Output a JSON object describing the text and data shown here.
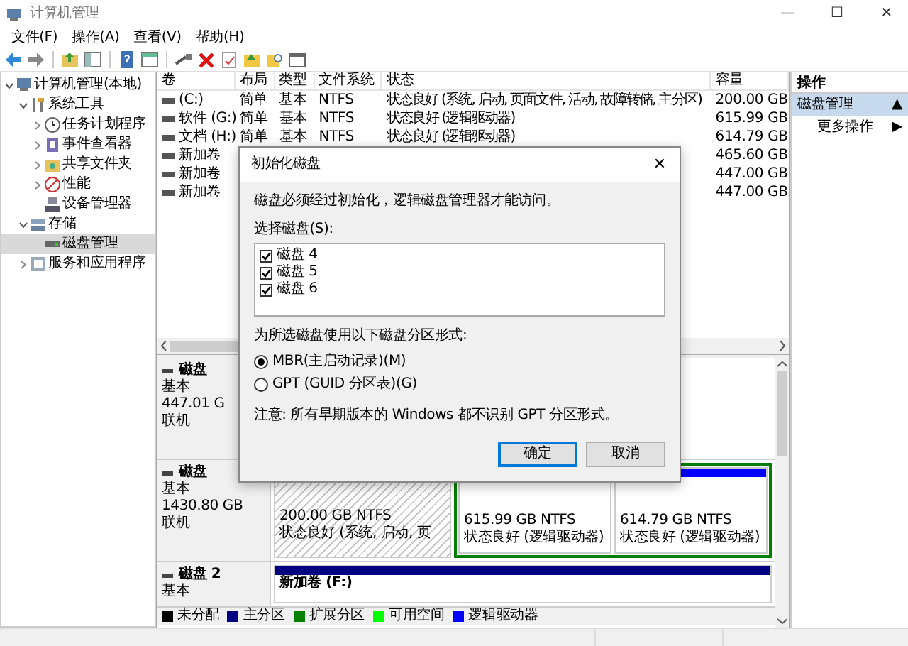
{
  "window": {
    "title": "计算机管理",
    "controls": [
      "—",
      "☐",
      "✕"
    ]
  },
  "menu": [
    "文件(F)",
    "操作(A)",
    "查看(V)",
    "帮助(H)"
  ],
  "tree": [
    {
      "label": "计算机管理(本地)",
      "selected": false,
      "expanded": true,
      "children": [
        {
          "label": "系统工具",
          "selected": false,
          "expanded": true,
          "children": [
            {
              "label": "任务计划程序",
              "selected": false,
              "expanded": false
            },
            {
              "label": "事件查看器",
              "selected": false,
              "expanded": false
            },
            {
              "label": "共享文件夹",
              "selected": false,
              "expanded": false
            },
            {
              "label": "性能",
              "selected": false,
              "expanded": false
            },
            {
              "label": "设备管理器",
              "selected": false
            }
          ]
        },
        {
          "label": "存储",
          "selected": false,
          "expanded": true,
          "children": [
            {
              "label": "磁盘管理",
              "selected": true
            }
          ]
        },
        {
          "label": "服务和应用程序",
          "selected": false,
          "expanded": false
        }
      ]
    }
  ],
  "volumes": {
    "columns": [
      "卷",
      "布局",
      "类型",
      "文件系统",
      "状态",
      "容量"
    ],
    "rows": [
      {
        "volume": "(C:)",
        "layout": "简单",
        "type": "基本",
        "file_system": "NTFS",
        "status": "状态良好 (系统, 启动, 页面文件, 活动, 故障转储, 主分区)",
        "capacity": "200.00 GB"
      },
      {
        "volume": "软件 (G:)",
        "layout": "简单",
        "type": "基本",
        "file_system": "NTFS",
        "status": "状态良好 (逻辑驱动器)",
        "capacity": "615.99 GB"
      },
      {
        "volume": "文档 (H:)",
        "layout": "简单",
        "type": "基本",
        "file_system": "NTFS",
        "status": "状态良好 (逻辑驱动器)",
        "capacity": "614.79 GB"
      },
      {
        "volume": "新加卷",
        "capacity": "465.60 GB"
      },
      {
        "volume": "新加卷",
        "capacity": "447.00 GB"
      },
      {
        "volume": "新加卷",
        "capacity": "447.00 GB"
      }
    ]
  },
  "disks": [
    {
      "name": "磁盘",
      "type": "基本",
      "size": "447.01 G",
      "status": "联机"
    },
    {
      "name": "磁盘",
      "type": "基本",
      "size": "1430.80 GB",
      "status": "联机",
      "partitions": [
        {
          "kind": "primary",
          "selected": true,
          "lines": [
            "200.00 GB NTFS",
            "状态良好 (系统, 启动, 页"
          ]
        },
        {
          "kind": "extended",
          "children": [
            {
              "kind": "logical",
              "selected": false,
              "lines": [
                "615.99 GB NTFS",
                "状态良好 (逻辑驱动器)"
              ]
            },
            {
              "kind": "logical",
              "selected": false,
              "lines": [
                "614.79 GB NTFS",
                "状态良好 (逻辑驱动器)"
              ]
            }
          ]
        }
      ]
    },
    {
      "name": "磁盘 2",
      "type": "基本",
      "partitions": [
        {
          "kind": "primary",
          "selected": false,
          "title": "新加卷  (F:)"
        }
      ]
    }
  ],
  "legend": [
    {
      "label": "未分配",
      "color": "#000000"
    },
    {
      "label": "主分区",
      "color": "#000080"
    },
    {
      "label": "扩展分区",
      "color": "#008000"
    },
    {
      "label": "可用空间",
      "color": "#00ff00"
    },
    {
      "label": "逻辑驱动器",
      "color": "#0000ff"
    }
  ],
  "actions": {
    "title": "操作",
    "items": [
      {
        "label": "磁盘管理",
        "arrow": "▲",
        "selected": true
      },
      {
        "label": "更多操作",
        "arrow": "▶",
        "selected": false
      }
    ]
  },
  "dialog": {
    "title": "初始化磁盘",
    "close": "✕",
    "message": "磁盘必须经过初始化，逻辑磁盘管理器才能访问。",
    "list_label": "选择磁盘(S):",
    "disks": [
      {
        "label": "磁盘 4",
        "checked": true
      },
      {
        "label": "磁盘 5",
        "checked": true
      },
      {
        "label": "磁盘 6",
        "checked": true
      }
    ],
    "style_label": "为所选磁盘使用以下磁盘分区形式:",
    "styles": [
      {
        "label": "MBR(主启动记录)(M)",
        "selected": true
      },
      {
        "label": "GPT (GUID 分区表)(G)",
        "selected": false
      }
    ],
    "note": "注意: 所有早期版本的 Windows 都不识别 GPT 分区形式。",
    "buttons": [
      {
        "label": "确定",
        "default": true
      },
      {
        "label": "取消",
        "default": false
      }
    ]
  }
}
